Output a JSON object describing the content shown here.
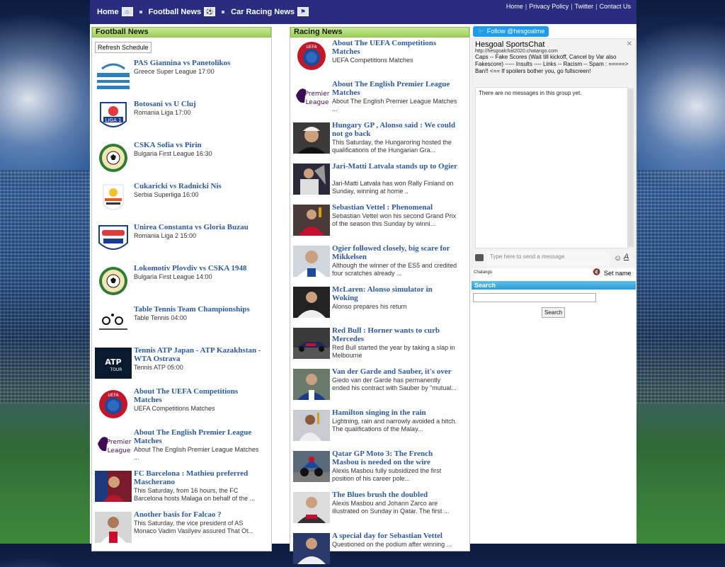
{
  "header": {
    "nav": [
      {
        "label": "Home",
        "icon": "home-icon"
      },
      {
        "label": "Football News",
        "icon": "football-icon"
      },
      {
        "label": "Car Racing News",
        "icon": "racing-icon"
      }
    ],
    "links": [
      "Home",
      "Privacy Policy",
      "Twitter",
      "Contact Us"
    ]
  },
  "football": {
    "title": "Football News",
    "refresh_label": "Refresh Schedule",
    "items": [
      {
        "title": "PAS Giannina vs Panetolikos",
        "desc": "Greece Super League 17:00"
      },
      {
        "title": "Botosani vs U Cluj",
        "desc": "Romania Liga 17:00"
      },
      {
        "title": "CSKA Sofia vs Pirin",
        "desc": "Bulgaria First League 16:30"
      },
      {
        "title": "Cukaricki vs Radnicki Nis",
        "desc": "Serbia Superliga 16:00"
      },
      {
        "title": "Unirea Constanta vs Gloria Buzau",
        "desc": "Romania Liga 2 15:00"
      },
      {
        "title": "Lokomotiv Plovdiv vs CSKA 1948",
        "desc": "Bulgaria First League 14:00"
      },
      {
        "title": "Table Tennis Team Championships",
        "desc": "Table Tennis 04:00"
      },
      {
        "title": "Tennis ATP Japan - ATP Kazakhstan - WTA Ostrava",
        "desc": "Tennis ATP 05:00"
      },
      {
        "title": "About The UEFA Competitions Matches",
        "desc": "UEFA Competitions Matches"
      },
      {
        "title": "About The English Premier League Matches",
        "desc": "About The English Premier League Matches ..."
      },
      {
        "title": "FC Barcelona : Mathieu preferred Mascherano",
        "desc": "This Saturday, from 16 hours, the FC Barcelona hosts Malaga on behalf of the ..."
      },
      {
        "title": "Another basis for Falcao ?",
        "desc": "This Saturday, the vice president of AS Monaco Vadim Vasilyev assured That Ot..."
      }
    ]
  },
  "racing": {
    "title": "Racing News",
    "items": [
      {
        "title": "About The UEFA Competitions Matches",
        "desc": "UEFA Competitions Matches"
      },
      {
        "title": "About The English Premier League Matches",
        "desc": "About The English Premier League Matches ..."
      },
      {
        "title": "Hungary GP , Alonso said : We could not go back",
        "desc": "This Saturday, the Hungaroring hosted the qualifications of the Hungarian Gra..."
      },
      {
        "title": "Jari-Matti Latvala stands up to Ogier",
        "desc": "Jari-Matti Latvala has won Rally Finland on Sunday, winning at home .."
      },
      {
        "title": "Sebastian Vettel : Phenomenal",
        "desc": "Sebastian Vettel won his second Grand Prix of the season this Sunday by winni..."
      },
      {
        "title": "Ogier followed closely, big scare for Mikkelsen",
        "desc": "Although the winner of the ES5 and credited four scratches already ..."
      },
      {
        "title": "McLaren: Alonso simulator in Woking",
        "desc": "Alonso prepares his return"
      },
      {
        "title": "Red Bull : Horner wants to curb Mercedes",
        "desc": "Red Bull started the year by taking a slap in Melbourne"
      },
      {
        "title": "Van der Garde and Sauber, it's over",
        "desc": "Giedo van der Garde has permanently ended his contract with Sauber by \"mutual..."
      },
      {
        "title": "Hamilton singing in the rain",
        "desc": "Lightning, rain and narrowly avoided a hitch. The qualifications of the Malay..."
      },
      {
        "title": "Qatar GP Moto 3: The French Masbou is needed on the wire",
        "desc": "Alexis Masbou fully subsidized the first position of his career pole..."
      },
      {
        "title": "The Blues brush the doubled",
        "desc": "Alexis Masbou and Johann Zarco are illustrated on Sunday in Qatar. The first ..."
      },
      {
        "title": "A special day for Sebastian Vettel",
        "desc": "Questioned on the podium after winning ..."
      }
    ]
  },
  "sidebar": {
    "twitter_label": "Follow @hesgoalme",
    "chat": {
      "title": "Hesgoal SportsChat",
      "url": "http://hesgoalchat2020.chatango.com",
      "rules": "Caps -- Fake Scores (Wait till kickoff, Cancel by Var also Fakescore) ----- Insults ---- Links -- Racism -- Spam : =====> Ban!! <== If spoilers bother you, go fullscreen!",
      "empty": "There are no messages in this group yet.",
      "input_placeholder": "Type here to send a message",
      "brand": "Chatango",
      "set_name": "Set name"
    },
    "search": {
      "title": "Search",
      "button": "Search"
    }
  }
}
